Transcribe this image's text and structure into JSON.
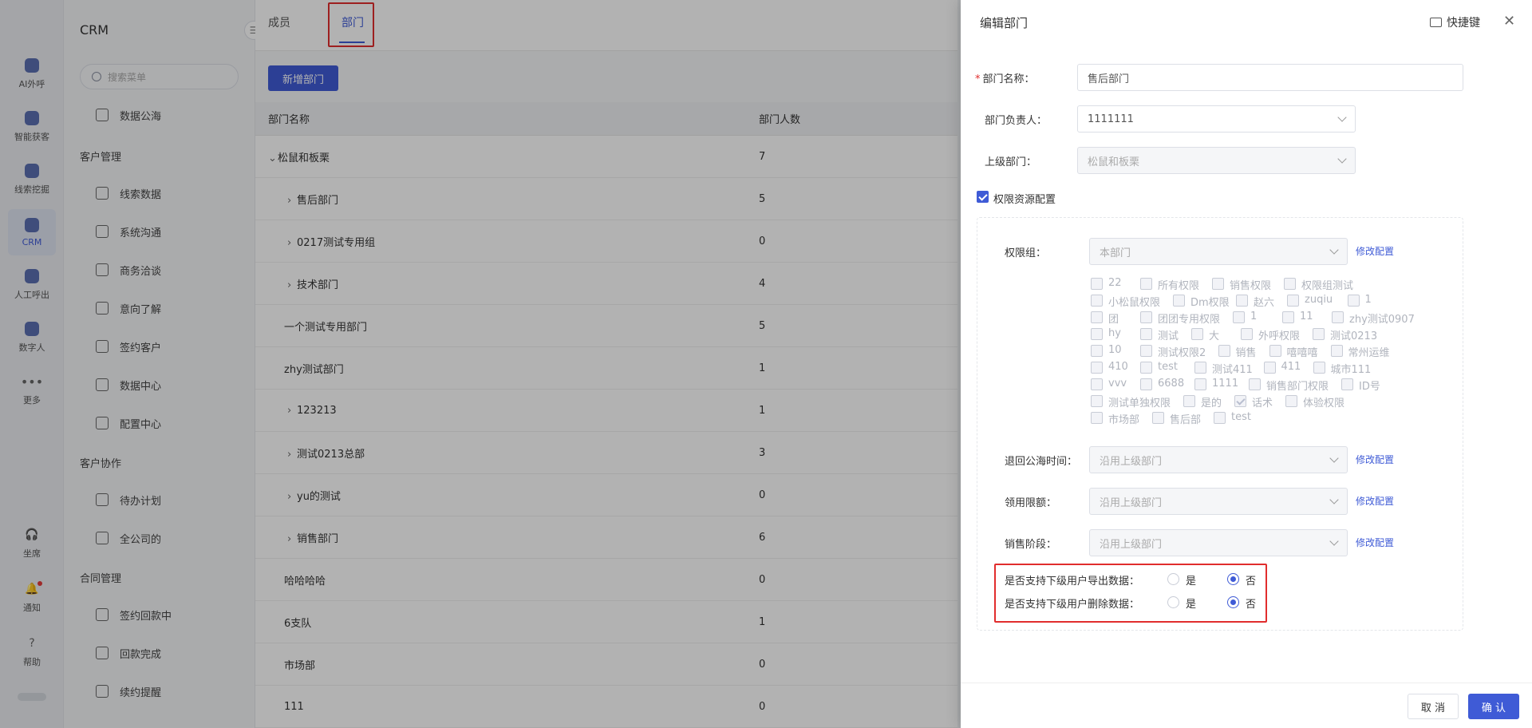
{
  "rail": {
    "items": [
      {
        "label": "AI外呼",
        "icon": "ai-call-icon"
      },
      {
        "label": "智能获客",
        "icon": "acquisition-icon"
      },
      {
        "label": "线索挖掘",
        "icon": "lead-mining-icon"
      },
      {
        "label": "CRM",
        "icon": "crm-icon",
        "active": true
      },
      {
        "label": "人工呼出",
        "icon": "manual-call-icon"
      },
      {
        "label": "数字人",
        "icon": "digital-human-icon"
      },
      {
        "label": "更多",
        "icon": "more-icon"
      }
    ],
    "bottom": [
      {
        "label": "坐席",
        "icon": "headset-icon"
      },
      {
        "label": "通知",
        "icon": "bell-icon"
      },
      {
        "label": "帮助",
        "icon": "help-icon"
      }
    ]
  },
  "menu": {
    "title": "CRM",
    "search_placeholder": "搜索菜单",
    "top_item": "数据公海",
    "groups": [
      {
        "title": "客户管理",
        "items": [
          "线索数据",
          "系统沟通",
          "商务洽谈",
          "意向了解",
          "签约客户",
          "数据中心",
          "配置中心"
        ]
      },
      {
        "title": "客户协作",
        "items": [
          "待办计划",
          "全公司的"
        ]
      },
      {
        "title": "合同管理",
        "items": [
          "签约回款中",
          "回款完成",
          "续约提醒"
        ]
      }
    ]
  },
  "main": {
    "tabs": [
      "成员",
      "部门"
    ],
    "active_tab": "部门",
    "add_button": "新增部门",
    "columns": [
      "部门名称",
      "部门人数"
    ],
    "rows": [
      {
        "name": "松鼠和板栗",
        "count": "7",
        "expander": "⌄",
        "indent": 0
      },
      {
        "name": "售后部门",
        "count": "5",
        "expander": "›",
        "indent": 1
      },
      {
        "name": "0217测试专用组",
        "count": "0",
        "expander": "›",
        "indent": 1
      },
      {
        "name": "技术部门",
        "count": "4",
        "expander": "›",
        "indent": 1
      },
      {
        "name": "一个测试专用部门",
        "count": "5",
        "expander": "",
        "indent": 1
      },
      {
        "name": "zhy测试部门",
        "count": "1",
        "expander": "",
        "indent": 1
      },
      {
        "name": "123213",
        "count": "1",
        "expander": "›",
        "indent": 1
      },
      {
        "name": "测试0213总部",
        "count": "3",
        "expander": "›",
        "indent": 1
      },
      {
        "name": "yu的测试",
        "count": "0",
        "expander": "›",
        "indent": 1
      },
      {
        "name": "销售部门",
        "count": "6",
        "expander": "›",
        "indent": 1
      },
      {
        "name": "哈哈哈哈",
        "count": "0",
        "expander": "",
        "indent": 1
      },
      {
        "name": "6支队",
        "count": "1",
        "expander": "",
        "indent": 1
      },
      {
        "name": "市场部",
        "count": "0",
        "expander": "",
        "indent": 1
      },
      {
        "name": "111",
        "count": "0",
        "expander": "",
        "indent": 1
      }
    ]
  },
  "drawer": {
    "title": "编辑部门",
    "shortcut": "快捷键",
    "fields": {
      "name_label": "部门名称：",
      "name_value": "售后部门",
      "leader_label": "部门负责人：",
      "leader_value": "1111111",
      "parent_label": "上级部门：",
      "parent_value": "松鼠和板栗"
    },
    "perm_checkbox": "权限资源配置",
    "perm_group_label": "权限组：",
    "perm_group_value": "本部门",
    "modify_link": "修改配置",
    "perm_options": [
      [
        "22",
        "所有权限",
        "销售权限",
        "权限组测试"
      ],
      [
        "小松鼠权限",
        "Dm权限",
        "赵六",
        "zuqiu",
        "1"
      ],
      [
        "团",
        "团团专用权限",
        "1",
        "11",
        "zhy测试0907"
      ],
      [
        "hy",
        "测试",
        "大",
        "外呼权限",
        "测试0213"
      ],
      [
        "10",
        "测试权限2",
        "销售",
        "嘻嘻嘻",
        "常州运维"
      ],
      [
        "410",
        "test",
        "测试411",
        "411",
        "城市111"
      ],
      [
        "vvv",
        "6688",
        "1111",
        "销售部门权限",
        "ID号"
      ],
      [
        "测试单独权限",
        "是的",
        "话术",
        "体验权限"
      ],
      [
        "市场部",
        "售后部",
        "test"
      ]
    ],
    "checked_option": "话术",
    "return_label": "退回公海时间：",
    "return_value": "沿用上级部门",
    "quota_label": "领用限额：",
    "quota_value": "沿用上级部门",
    "stage_label": "销售阶段：",
    "stage_value": "沿用上级部门",
    "export_label": "是否支持下级用户导出数据：",
    "delete_label": "是否支持下级用户删除数据：",
    "yes": "是",
    "no": "否",
    "export_selected": "否",
    "delete_selected": "否",
    "cancel": "取 消",
    "confirm": "确 认"
  }
}
